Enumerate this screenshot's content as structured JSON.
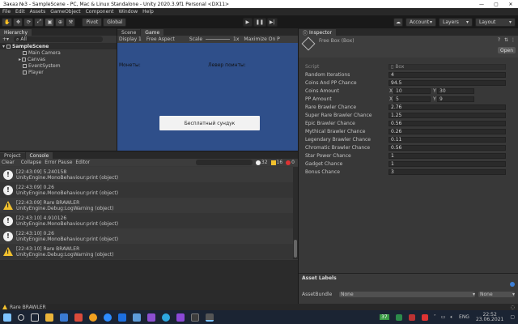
{
  "window": {
    "title": "Заказ №3 - SampleScene - PC, Mac & Linux Standalone - Unity 2020.3.9f1 Personal <DX11>",
    "ctrls": [
      "—",
      "▢",
      "✕"
    ]
  },
  "menu": [
    "File",
    "Edit",
    "Assets",
    "GameObject",
    "Component",
    "Window",
    "Help"
  ],
  "toolbar": {
    "pivot": "Pivot",
    "global": "Global",
    "account": "Account",
    "layers": "Layers",
    "layout": "Layout"
  },
  "hierarchy": {
    "tab": "Hierarchy",
    "search_label": "All",
    "scene": "SampleScene",
    "items": [
      "Main Camera",
      "Canvas",
      "EventSystem",
      "Player"
    ]
  },
  "scene_view": {
    "tabs": [
      "Scene",
      "Game"
    ],
    "display": "Display 1",
    "aspect": "Free Aspect",
    "scale_label": "Scale",
    "scale_value": "1x",
    "maximize": "Maximize On P",
    "label_left": "Монеты:",
    "label_right": "Левер поинты:",
    "button": "Бесплатный сундук"
  },
  "console": {
    "tabs": [
      "Project",
      "Console"
    ],
    "toolbar": {
      "clear": "Clear",
      "collapse": "Collapse",
      "error_pause": "Error Pause",
      "editor": "Editor"
    },
    "counts": {
      "info": "32",
      "warn": "16",
      "error": "0"
    },
    "entries": [
      {
        "type": "info",
        "line1": "[22:43:09] 5.240158",
        "line2": "UnityEngine.MonoBehaviour:print (object)"
      },
      {
        "type": "info",
        "line1": "[22:43:09] 0.26",
        "line2": "UnityEngine.MonoBehaviour:print (object)"
      },
      {
        "type": "warn",
        "line1": "[22:43:09] Rare BRAWLER",
        "line2": "UnityEngine.Debug:LogWarning (object)"
      },
      {
        "type": "info",
        "line1": "[22:43:10] 4.910126",
        "line2": "UnityEngine.MonoBehaviour:print (object)"
      },
      {
        "type": "info",
        "line1": "[22:43:10] 0.26",
        "line2": "UnityEngine.MonoBehaviour:print (object)"
      },
      {
        "type": "warn",
        "line1": "[22:43:10] Rare BRAWLER",
        "line2": "UnityEngine.Debug:LogWarning (object)"
      }
    ]
  },
  "inspector": {
    "tab": "Inspector",
    "object": "Free Box (Box)",
    "open": "Open",
    "script_label": "Script",
    "script_value": "Box",
    "props": [
      {
        "label": "Random Iterations",
        "value": "4"
      },
      {
        "label": "Coins And PP Chance",
        "value": "94.5"
      },
      {
        "label": "Coins Amount",
        "x": "10",
        "y": "30"
      },
      {
        "label": "PP Amount",
        "x": "5",
        "y": "9"
      },
      {
        "label": "Rare Brawler Chance",
        "value": "2.76"
      },
      {
        "label": "Super Rare Brawler Chance",
        "value": "1.25"
      },
      {
        "label": "Epic Brawler Chance",
        "value": "0.56"
      },
      {
        "label": "Mythical Brawler Chance",
        "value": "0.26"
      },
      {
        "label": "Legendary Brawler Chance",
        "value": "0.11"
      },
      {
        "label": "Chromatic Brawler Chance",
        "value": "0.56"
      },
      {
        "label": "Star Power Chance",
        "value": "1"
      },
      {
        "label": "Gadget Chance",
        "value": "1"
      },
      {
        "label": "Bonus Chance",
        "value": "3"
      }
    ],
    "asset_labels": "Asset Labels",
    "asset_bundle": "AssetBundle",
    "bundle_value": "None",
    "variant_value": "None"
  },
  "status": {
    "text": "Rare BRAWLER"
  },
  "taskbar": {
    "lang": "ENG",
    "time": "22:52",
    "date": "23.06.2021",
    "temp": "37"
  }
}
